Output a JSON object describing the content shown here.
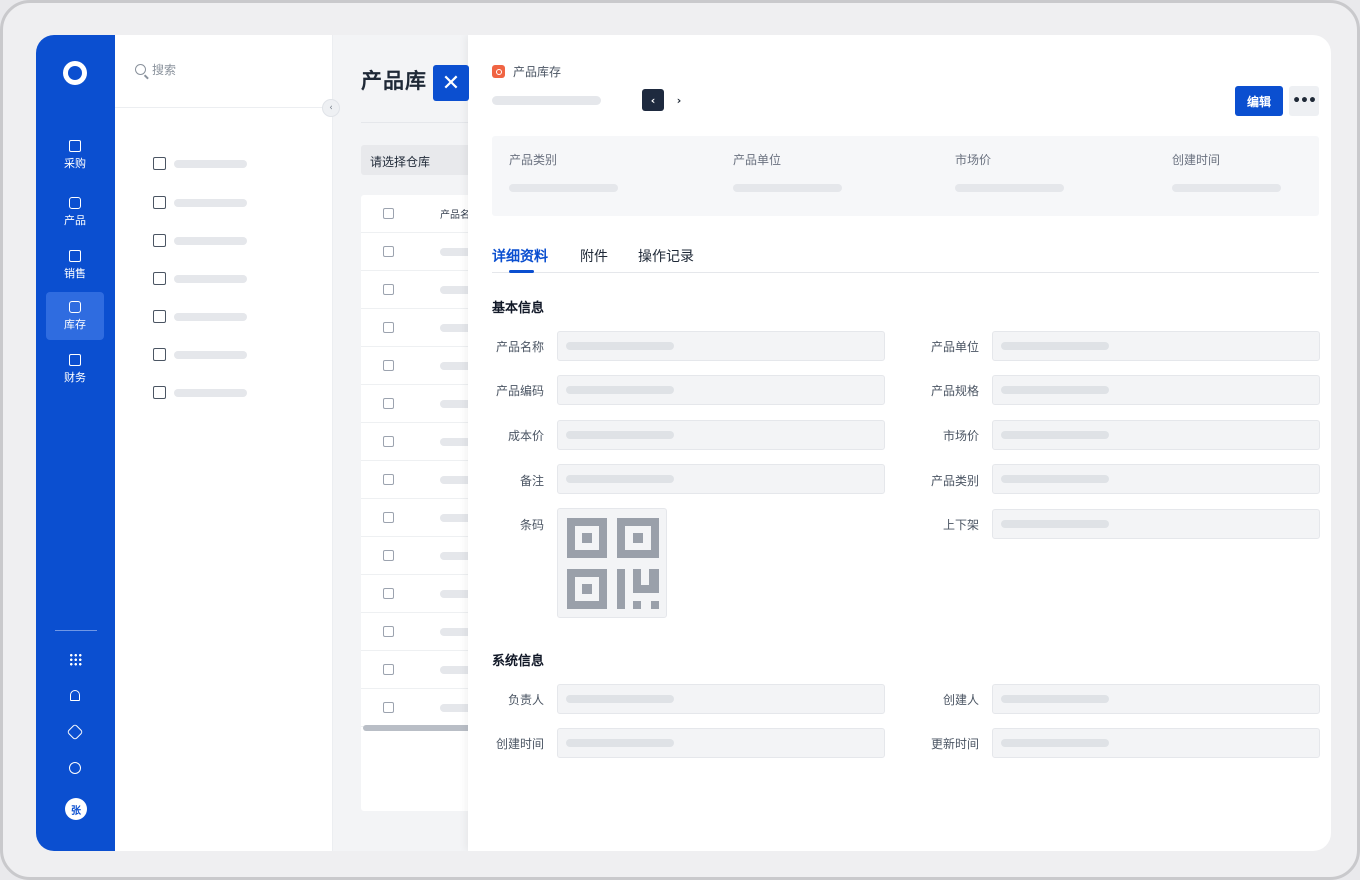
{
  "rail": {
    "items": [
      {
        "label": "采购",
        "icon": "bag-icon"
      },
      {
        "label": "产品",
        "icon": "box-icon"
      },
      {
        "label": "销售",
        "icon": "chart-icon"
      },
      {
        "label": "库存",
        "icon": "inventory-icon",
        "active": true
      },
      {
        "label": "财务",
        "icon": "yuan-icon"
      }
    ],
    "tools": [
      "apps-grid-icon",
      "bell-icon",
      "settings-icon",
      "help-icon"
    ],
    "avatar_text": "张"
  },
  "sidebar": {
    "search_placeholder": "搜索",
    "items": [
      "home-icon",
      "calendar-icon",
      "warehouse-icon",
      "warehouse-settings-icon",
      "doc-icon",
      "search-doc-icon",
      "list-icon"
    ]
  },
  "main": {
    "title": "产品库",
    "warehouse_select": "请选择仓库",
    "table_header": "产品名"
  },
  "drawer": {
    "breadcrumb": "产品库存",
    "edit_label": "编辑",
    "more_label": "•••",
    "summary": [
      {
        "label": "产品类别"
      },
      {
        "label": "产品单位"
      },
      {
        "label": "市场价"
      },
      {
        "label": "创建时间"
      }
    ],
    "tabs": [
      {
        "label": "详细资料",
        "active": true
      },
      {
        "label": "附件"
      },
      {
        "label": "操作记录"
      }
    ],
    "basic_title": "基本信息",
    "basic_fields": {
      "name": "产品名称",
      "unit": "产品单位",
      "code": "产品编码",
      "spec": "产品规格",
      "cost": "成本价",
      "market": "市场价",
      "note": "备注",
      "category": "产品类别",
      "barcode": "条码",
      "shelf": "上下架"
    },
    "system_title": "系统信息",
    "system_fields": {
      "owner": "负责人",
      "creator": "创建人",
      "created": "创建时间",
      "updated": "更新时间"
    }
  },
  "colors": {
    "brand": "#0b4fd0",
    "accent_orange": "#f06443"
  }
}
